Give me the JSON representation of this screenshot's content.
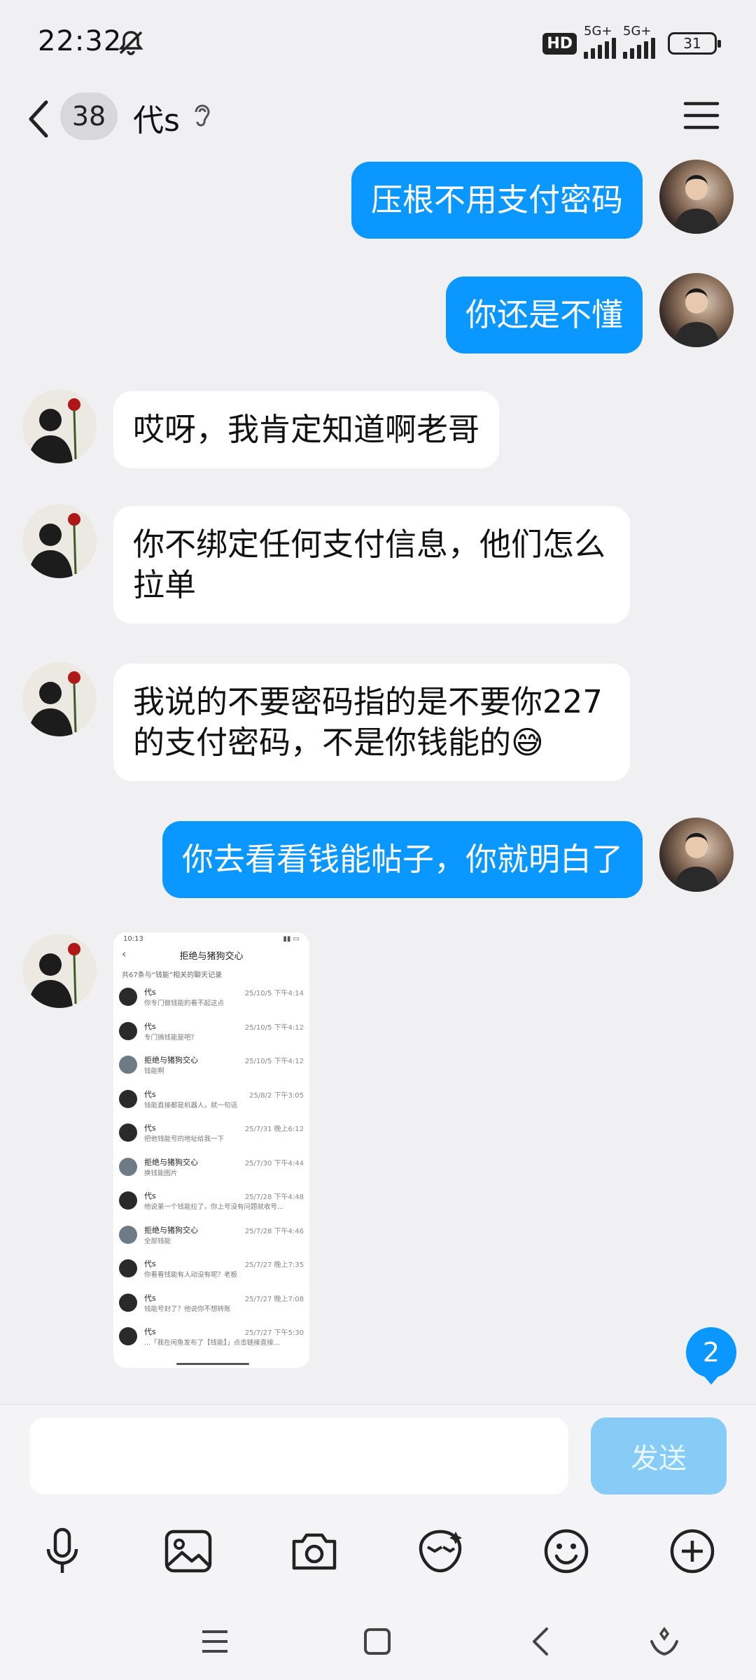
{
  "status_bar": {
    "time": "22:32",
    "hd_label": "HD",
    "signal1_label": "5G+",
    "signal2_label": "5G+",
    "battery": "31"
  },
  "header": {
    "unread_count": "38",
    "title": "代s"
  },
  "messages": [
    {
      "direction": "out",
      "text": "压根不用支付密码"
    },
    {
      "direction": "out",
      "text": "你还是不懂"
    },
    {
      "direction": "in",
      "text": "哎呀，我肯定知道啊老哥"
    },
    {
      "direction": "in",
      "text": "你不绑定任何支付信息，他们怎么拉单"
    },
    {
      "direction": "in",
      "text": "我说的不要密码指的是不要你227的支付密码，不是你钱能的😅"
    },
    {
      "direction": "out",
      "text": "你去看看钱能帖子，你就明白了"
    }
  ],
  "screenshot_message": {
    "time": "10:13",
    "title": "拒绝与猪狗交心",
    "subtitle": "共67条与“钱能”相关的聊天记录",
    "rows": [
      {
        "name": "代s",
        "time": "25/10/5 下午4:14",
        "preview": "你专门做钱能的看不起这点"
      },
      {
        "name": "代s",
        "time": "25/10/5 下午4:12",
        "preview": "专门搞钱能是吧?"
      },
      {
        "name": "拒绝与猪狗交心",
        "time": "25/10/5 下午4:12",
        "preview": "钱能啊"
      },
      {
        "name": "代s",
        "time": "25/8/2 下午3:05",
        "preview": "钱能直接都是机器人，就一句话"
      },
      {
        "name": "代s",
        "time": "25/7/31 晚上6:12",
        "preview": "把他钱能号的地址给我一下"
      },
      {
        "name": "拒绝与猪狗交心",
        "time": "25/7/30 下午4:44",
        "preview": "换钱能图片"
      },
      {
        "name": "代s",
        "time": "25/7/28 下午4:48",
        "preview": "他说第一个钱能拉了，你上号没有问题就收号..."
      },
      {
        "name": "拒绝与猪狗交心",
        "time": "25/7/28 下午4:46",
        "preview": "全部钱能"
      },
      {
        "name": "代s",
        "time": "25/7/27 晚上7:35",
        "preview": "你看看钱能有人动没有呢？老板"
      },
      {
        "name": "代s",
        "time": "25/7/27 晚上7:08",
        "preview": "钱能号封了？他说你不想转账"
      },
      {
        "name": "代s",
        "time": "25/7/27 下午5:30",
        "preview": "...「我在闲鱼发布了【钱能】」点击链接直接..."
      }
    ]
  },
  "new_message_count": "2",
  "composer": {
    "input_value": "",
    "send_label": "发送"
  },
  "toolbar_icons": [
    "microphone-icon",
    "image-icon",
    "camera-icon",
    "sticker-icon",
    "emoji-icon",
    "plus-icon"
  ],
  "nav_icons": [
    "menu-icon",
    "home-icon",
    "back-icon",
    "assistant-icon"
  ]
}
